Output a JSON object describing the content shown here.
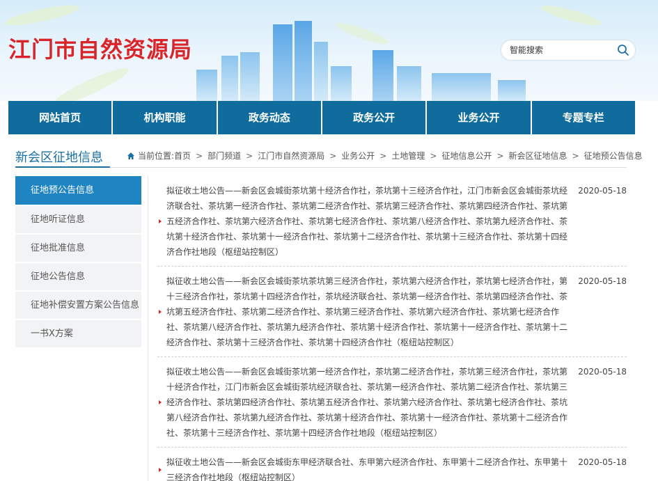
{
  "header": {
    "site_title": "江门市自然资源局",
    "search_placeholder": "智能搜索"
  },
  "nav": {
    "items": [
      {
        "label": "网站首页"
      },
      {
        "label": "机构职能"
      },
      {
        "label": "政务动态"
      },
      {
        "label": "政务公开"
      },
      {
        "label": "业务公开"
      },
      {
        "label": "专题专栏"
      }
    ]
  },
  "section": {
    "title": "新会区征地信息",
    "breadcrumb_prefix": "当前位置:",
    "breadcrumb": [
      "首页",
      "部门频道",
      "江门市自然资源局",
      "业务公开",
      "土地管理",
      "征地信息公开",
      "新会区征地信息",
      "征地预公告信息"
    ]
  },
  "sidebar": {
    "items": [
      {
        "label": "征地预公告信息",
        "active": true
      },
      {
        "label": "征地听证信息"
      },
      {
        "label": "征地批准信息"
      },
      {
        "label": "征地公告信息"
      },
      {
        "label": "征地补偿安置方案公告信息"
      },
      {
        "label": "一书X方案"
      }
    ]
  },
  "notices": [
    {
      "title": "拟征收土地公告——新会区会城街茶坑第十经济合作社，茶坑第十三经济合作社，江门市新会区会城街茶坑经济联合社、茶坑第一经济合作社、茶坑第二经济合作社、茶坑第三经济合作社、茶坑第四经济合作社、茶坑第五经济合作社、茶坑第六经济合作社、茶坑第七经济合作社、茶坑第八经济合作社、茶坑第九经济合作社、茶坑第十经济合作社、茶坑第十一经济合作社、茶坑第十二经济合作社、茶坑第十三经济合作社、茶坑第十四经济合作社地段（枢纽站控制区）",
      "date": "2020-05-18"
    },
    {
      "title": "拟征收土地公告——新会区会城街茶坑茶坑第三经济合作社，茶坑第六经济合作社，茶坑第七经济合作社，第十三经济合作社，茶坑第十四经济合作社，茶坑经济联合社、茶坑第一经济合作社、茶坑第四经济合作社、茶坑第五经济合作社、茶坑第二经济合作社、茶坑第三经济合作社、茶坑第六经济合作社、茶坑第七经济合作社、茶坑第八经济合作社、茶坑第九经济合作社、茶坑第十经济合作社、茶坑第十一经济合作社、茶坑第十二经济合作社、茶坑第十三经济合作社、茶坑第十四经济合作社（枢纽站控制区）",
      "date": "2020-05-18"
    },
    {
      "title": "拟征收土地公告——新会区会城街茶坑第一经济合作社，茶坑第二经济合作社，茶坑第三经济合作社，茶坑第十经济合作社，江门市新会区会城街茶坑经济联合社、茶坑第一经济合作社、茶坑第二经济合作社、茶坑第三经济合作社、茶坑第四经济合作社、茶坑第五经济合作社、茶坑第六经济合作社、茶坑第七经济合作社、茶坑第八经济合作社、茶坑第九经济合作社、茶坑第十经济合作社、茶坑第十一经济合作社、茶坑第十二经济合作社、茶坑第十三经济合作社、茶坑第十四经济合作社地段（枢纽站控制区）",
      "date": "2020-05-18"
    },
    {
      "title": "拟征收土地公告——新会区会城街东甲经济联合社、东甲第六经济合作社、东甲第十二经济合作社、东甲第十三经济合作社地段（枢纽站控制区）",
      "date": "2020-05-18"
    }
  ],
  "colors": {
    "brand_red": "#d9252a",
    "nav_blue": "#0f6c9c",
    "active_blue": "#1f84c2",
    "title_blue": "#1a6fa5"
  }
}
